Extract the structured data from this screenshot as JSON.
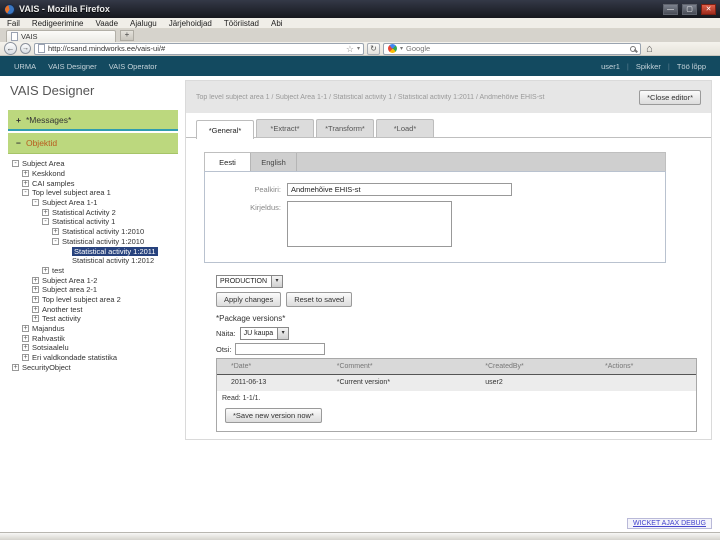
{
  "window": {
    "title": "VAIS - Mozilla Firefox"
  },
  "icons": {
    "minimize": "—",
    "maximize": "▢",
    "close": "✕",
    "back": "←",
    "forward": "→",
    "star": "☆",
    "caret": "▾",
    "reload": "↻",
    "home": "⌂",
    "new_tab": "+"
  },
  "browser": {
    "menus": [
      "Fail",
      "Redigeerimine",
      "Vaade",
      "Ajalugu",
      "Järjehoidjad",
      "Tööriistad",
      "Abi"
    ],
    "tab_label": "VAIS",
    "url": "http://csand.mindworks.ee/vais-ui/#",
    "search": {
      "placeholder": "Google"
    }
  },
  "appnav": {
    "left": [
      "URMA",
      "VAIS Designer",
      "VAIS Operator"
    ],
    "right": [
      "user1",
      "Spikker",
      "Töö lõpp"
    ]
  },
  "sidebar": {
    "title": "VAIS Designer",
    "accordion": [
      {
        "icon": "+",
        "label": "*Messages*"
      },
      {
        "icon": "−",
        "label": "Objektid"
      }
    ],
    "tree": [
      {
        "label": "Subject Area",
        "level": 0,
        "exp": "-"
      },
      {
        "label": "Keskkond",
        "level": 1,
        "exp": "+"
      },
      {
        "label": "CAI samples",
        "level": 1,
        "exp": "+"
      },
      {
        "label": "Top level subject area 1",
        "level": 1,
        "exp": "-"
      },
      {
        "label": "Subject Area 1-1",
        "level": 2,
        "exp": "-"
      },
      {
        "label": "Statistical Activity 2",
        "level": 3,
        "exp": "+"
      },
      {
        "label": "Statistical activity 1",
        "level": 3,
        "exp": "-"
      },
      {
        "label": "Statistical activity 1:2010",
        "level": 4,
        "exp": "+"
      },
      {
        "label": "Statistical activity 1:2010",
        "level": 4,
        "exp": "-"
      },
      {
        "label": "Statistical activity 1:2011",
        "level": 5,
        "exp": null,
        "selected": true
      },
      {
        "label": "Statistical activity 1:2012",
        "level": 5,
        "exp": null
      },
      {
        "label": "test",
        "level": 3,
        "exp": "+"
      },
      {
        "label": "Subject Area 1-2",
        "level": 2,
        "exp": "+"
      },
      {
        "label": "Subject area 2-1",
        "level": 2,
        "exp": "+"
      },
      {
        "label": "Top level subject area 2",
        "level": 2,
        "exp": "+"
      },
      {
        "label": "Another test",
        "level": 2,
        "exp": "+"
      },
      {
        "label": "Test activity",
        "level": 2,
        "exp": "+"
      },
      {
        "label": "Majandus",
        "level": 1,
        "exp": "+"
      },
      {
        "label": "Rahvastik",
        "level": 1,
        "exp": "+"
      },
      {
        "label": "Sotsiaalelu",
        "level": 1,
        "exp": "+"
      },
      {
        "label": "Eri valdkondade statistika",
        "level": 1,
        "exp": "+"
      },
      {
        "label": "SecurityObject",
        "level": 0,
        "exp": "+"
      }
    ]
  },
  "editor": {
    "breadcrumb": "Top level subject area 1 / Subject Area 1-1 / Statistical activity 1 / Statistical activity 1:2011 / Andmehõive EHIS-st",
    "close_button": "*Close editor*",
    "tabs": [
      "*General*",
      "*Extract*",
      "*Transform*",
      "*Load*"
    ],
    "active_tab": "*General*",
    "lang_tabs": [
      "Eesti",
      "English"
    ],
    "active_lang": "Eesti",
    "form": {
      "title_label": "Pealkiri:",
      "title_value": "Andmehõive EHIS-st",
      "desc_label": "Kirjeldus:",
      "desc_value": ""
    },
    "status_select": "PRODUCTION",
    "buttons": [
      "Apply changes",
      "Reset to saved"
    ],
    "versions": {
      "title": "*Package versions*",
      "filter_label": "Näita:",
      "filter_value": "JU kaupa",
      "search_label": "Otsi:",
      "search_value": "",
      "table": {
        "headers": [
          "*Date*",
          "*Comment*",
          "*CreatedBy*",
          "*Actions*"
        ],
        "rows": [
          [
            "2011-06-13",
            "*Current version*",
            "user2",
            ""
          ]
        ]
      },
      "pagination": "Read: 1-1/1.",
      "save_button": "*Save new version now*"
    }
  },
  "footer": {
    "debug_link": "WICKET AJAX DEBUG"
  },
  "colors": {
    "appnav_bg": "#134a60",
    "accordion_green": "#bcd87e",
    "accordion_divider": "#2f9cb0",
    "objektid_text": "#b85c1e",
    "tree_selected_bg": "#27427d",
    "titlebar_bg": "#15171d",
    "close_button_red": "#9c2a1c"
  }
}
